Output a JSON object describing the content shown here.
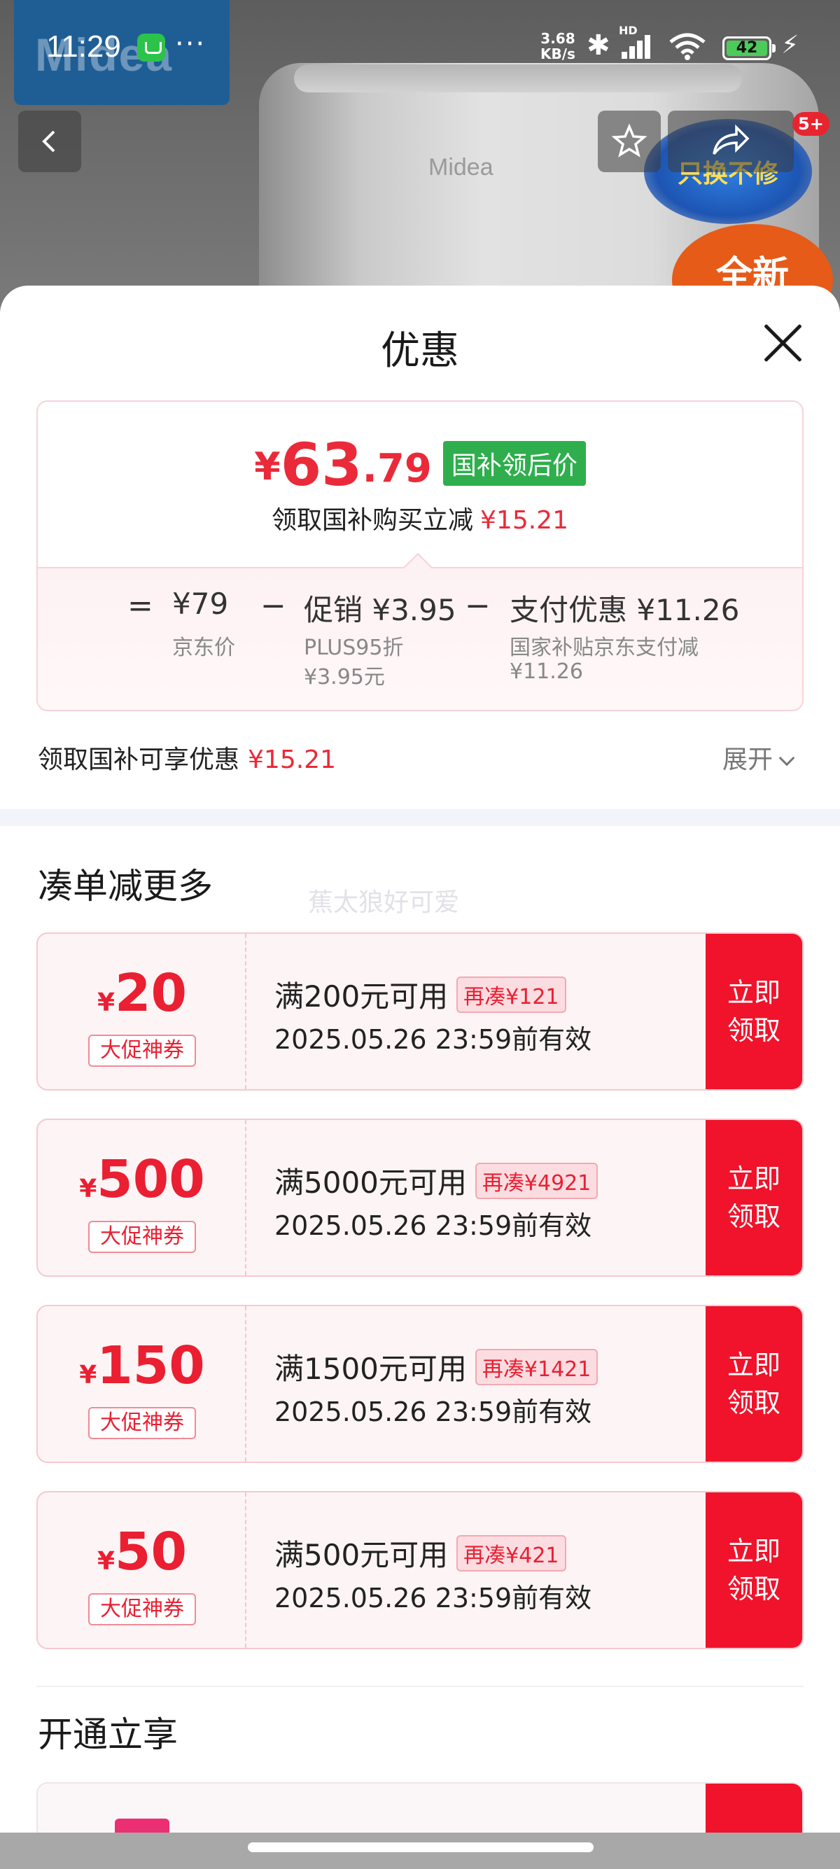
{
  "status_bar": {
    "time": "11:29",
    "more": "···",
    "net_speed_value": "3.68",
    "net_speed_unit": "KB/s",
    "network_label": "HD",
    "battery": "42"
  },
  "background": {
    "brand": "Midea",
    "product_logo": "Midea",
    "promo_badge": "只换不修",
    "promo_badge_2": "全新",
    "cart_badge": "5+"
  },
  "sheet": {
    "title": "优惠",
    "price_card": {
      "currency": "¥",
      "price_integer": "63",
      "price_decimal": ".79",
      "tag": "国补领后价",
      "subtitle": "领取国补购买立减",
      "subtitle_amount": "¥15.21",
      "calc": {
        "equals": "=",
        "jd_price": "¥79",
        "jd_price_label": "京东价",
        "minus1": "−",
        "promo": "促销 ¥3.95",
        "promo_note1": "PLUS95折",
        "promo_note2": "¥3.95元",
        "minus2": "−",
        "pay": "支付优惠 ¥11.26",
        "pay_note1": "国家补贴京东支付减",
        "pay_note2": "¥11.26"
      }
    },
    "benefit_label": "领取国补可享优惠",
    "benefit_amount": "¥15.21",
    "expand_label": "展开",
    "section_more": "凑单减更多",
    "watermark": "蕉太狼好可爱",
    "coupons": [
      {
        "yen": "¥",
        "amount": "20",
        "label": "大促神券",
        "condition": "满200元可用",
        "gap": "再凑¥121",
        "date": "2025.05.26 23:59前有效",
        "button_line1": "立即",
        "button_line2": "领取"
      },
      {
        "yen": "¥",
        "amount": "500",
        "label": "大促神券",
        "condition": "满5000元可用",
        "gap": "再凑¥4921",
        "date": "2025.05.26 23:59前有效",
        "button_line1": "立即",
        "button_line2": "领取"
      },
      {
        "yen": "¥",
        "amount": "150",
        "label": "大促神券",
        "condition": "满1500元可用",
        "gap": "再凑¥1421",
        "date": "2025.05.26 23:59前有效",
        "button_line1": "立即",
        "button_line2": "领取"
      },
      {
        "yen": "¥",
        "amount": "50",
        "label": "大促神券",
        "condition": "满500元可用",
        "gap": "再凑¥421",
        "date": "2025.05.26 23:59前有效",
        "button_line1": "立即",
        "button_line2": "领取"
      }
    ],
    "section_open": "开通立享"
  },
  "colors": {
    "accent_red": "#ea2a39",
    "button_red": "#f0132b",
    "tag_green": "#2fae4d"
  }
}
